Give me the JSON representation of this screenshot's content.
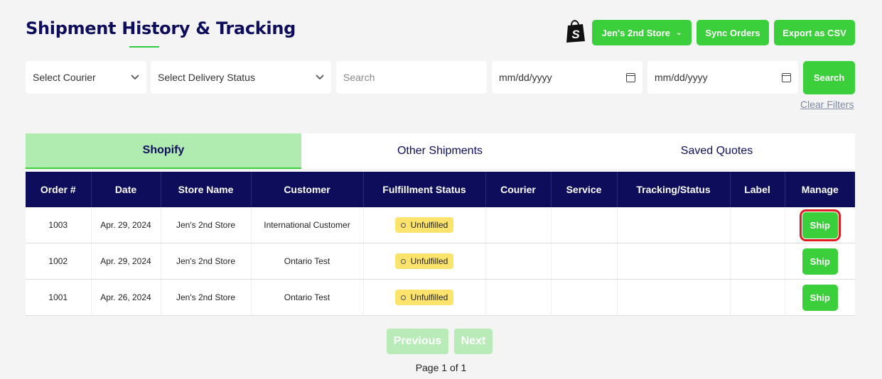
{
  "header": {
    "title": "Shipment History & Tracking",
    "store_button": "Jen's 2nd Store",
    "sync_button": "Sync Orders",
    "export_button": "Export as CSV",
    "logo_icon": "shopify-bag-icon"
  },
  "filters": {
    "courier_select": "Select Courier",
    "delivery_select": "Select Delivery Status",
    "search_placeholder": "Search",
    "date_from": "mm/dd/yyyy",
    "date_to": "mm/dd/yyyy",
    "search_button": "Search",
    "clear_filters": "Clear Filters"
  },
  "tabs": [
    {
      "label": "Shopify",
      "active": true
    },
    {
      "label": "Other Shipments",
      "active": false
    },
    {
      "label": "Saved Quotes",
      "active": false
    }
  ],
  "table": {
    "columns": [
      "Order #",
      "Date",
      "Store Name",
      "Customer",
      "Fulfillment Status",
      "Courier",
      "Service",
      "Tracking/Status",
      "Label",
      "Manage"
    ],
    "rows": [
      {
        "order": "1003",
        "date": "Apr. 29, 2024",
        "store": "Jen's 2nd Store",
        "customer": "International Customer",
        "status": "Unfulfilled",
        "courier": "",
        "service": "",
        "tracking": "",
        "label": "",
        "action": "Ship"
      },
      {
        "order": "1002",
        "date": "Apr. 29, 2024",
        "store": "Jen's 2nd Store",
        "customer": "Ontario Test",
        "status": "Unfulfilled",
        "courier": "",
        "service": "",
        "tracking": "",
        "label": "",
        "action": "Ship"
      },
      {
        "order": "1001",
        "date": "Apr. 26, 2024",
        "store": "Jen's 2nd Store",
        "customer": "Ontario Test",
        "status": "Unfulfilled",
        "courier": "",
        "service": "",
        "tracking": "",
        "label": "",
        "action": "Ship"
      }
    ]
  },
  "pagination": {
    "previous": "Previous",
    "next": "Next",
    "page_info": "Page 1 of 1"
  },
  "colors": {
    "brand_navy": "#0e0d5c",
    "accent_green": "#3ccf3c",
    "status_yellow": "#fbe36c",
    "highlight_red": "#e01a22"
  }
}
